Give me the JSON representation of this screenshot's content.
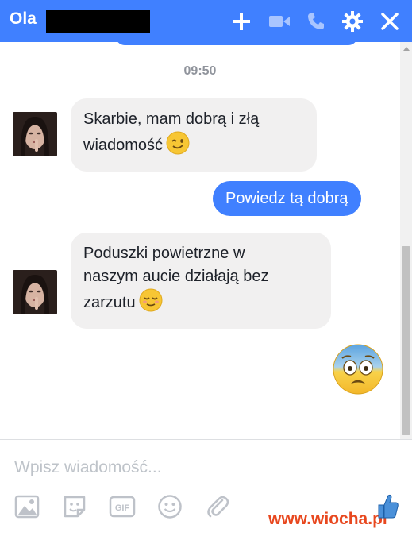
{
  "header": {
    "contact_name": "Ola",
    "icons": [
      "plus-icon",
      "video-camera-icon",
      "phone-icon",
      "gear-icon",
      "close-icon"
    ],
    "background_color": "#4080ff"
  },
  "conversation": {
    "timestamp": "09:50",
    "messages": [
      {
        "sender": "Ola",
        "direction": "incoming",
        "lines": [
          "Skarbie, mam dobrą i złą",
          "wiadomość"
        ],
        "emoji": "winking-face"
      },
      {
        "sender": "me",
        "direction": "outgoing",
        "text": "Powiedz tą dobrą"
      },
      {
        "sender": "Ola",
        "direction": "incoming",
        "lines": [
          "Poduszki powietrzne w",
          "naszym aucie działają bez",
          "zarzutu"
        ],
        "emoji": "relieved-face"
      },
      {
        "sender": "me",
        "direction": "outgoing",
        "emoji": "fearful-face"
      }
    ]
  },
  "composer": {
    "placeholder": "Wpisz wiadomość...",
    "tools": [
      "photo-icon",
      "sticker-icon",
      "gif-icon",
      "emoji-icon",
      "attachment-icon"
    ]
  },
  "watermark": {
    "text": "www.wiocha.pl"
  },
  "colors": {
    "accent": "#4080ff",
    "incoming_bubble": "#f1f0f0",
    "watermark": "#e8481f"
  }
}
